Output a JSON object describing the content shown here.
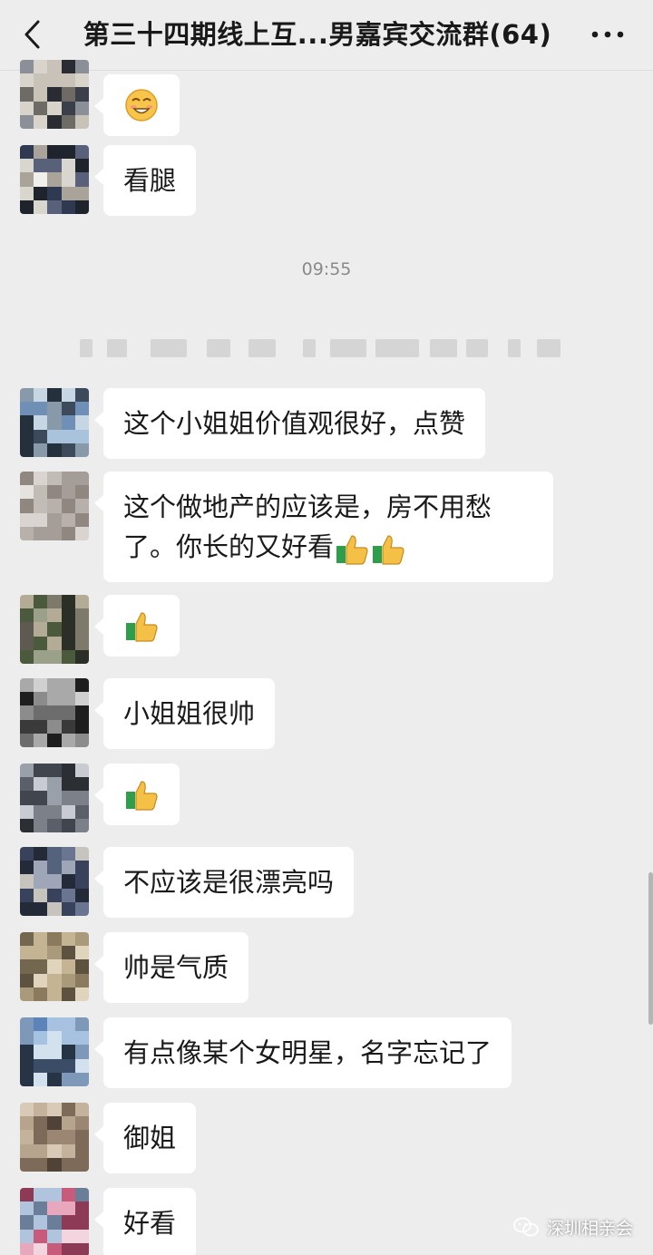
{
  "header": {
    "title": "第三十四期线上互...男嘉宾交流群(64)"
  },
  "divider": {
    "time": "09:55"
  },
  "messages": [
    {
      "text": "",
      "content_icon": "grinning-face-emoji"
    },
    {
      "text": "看腿"
    },
    {
      "text": "这个小姐姐价值观很好，点赞"
    },
    {
      "text": "这个做地产的应该是，房不用愁了。你长的又好看",
      "trailing_icons": [
        "thumbs-up-emoji",
        "thumbs-up-emoji"
      ]
    },
    {
      "text": "",
      "content_icon": "thumbs-up-emoji"
    },
    {
      "text": "小姐姐很帅"
    },
    {
      "text": "",
      "content_icon": "thumbs-up-emoji"
    },
    {
      "text": "不应该是很漂亮吗"
    },
    {
      "text": "帅是气质"
    },
    {
      "text": "有点像某个女明星，名字忘记了"
    },
    {
      "text": "御姐"
    },
    {
      "text": "好看"
    }
  ],
  "watermark": {
    "text": "深圳相亲会",
    "icon": "wechat-official-account-icon"
  },
  "colors": {
    "background": "#ededed",
    "bubble": "#ffffff",
    "text": "#191919",
    "timestamp": "#8a8a8a"
  }
}
